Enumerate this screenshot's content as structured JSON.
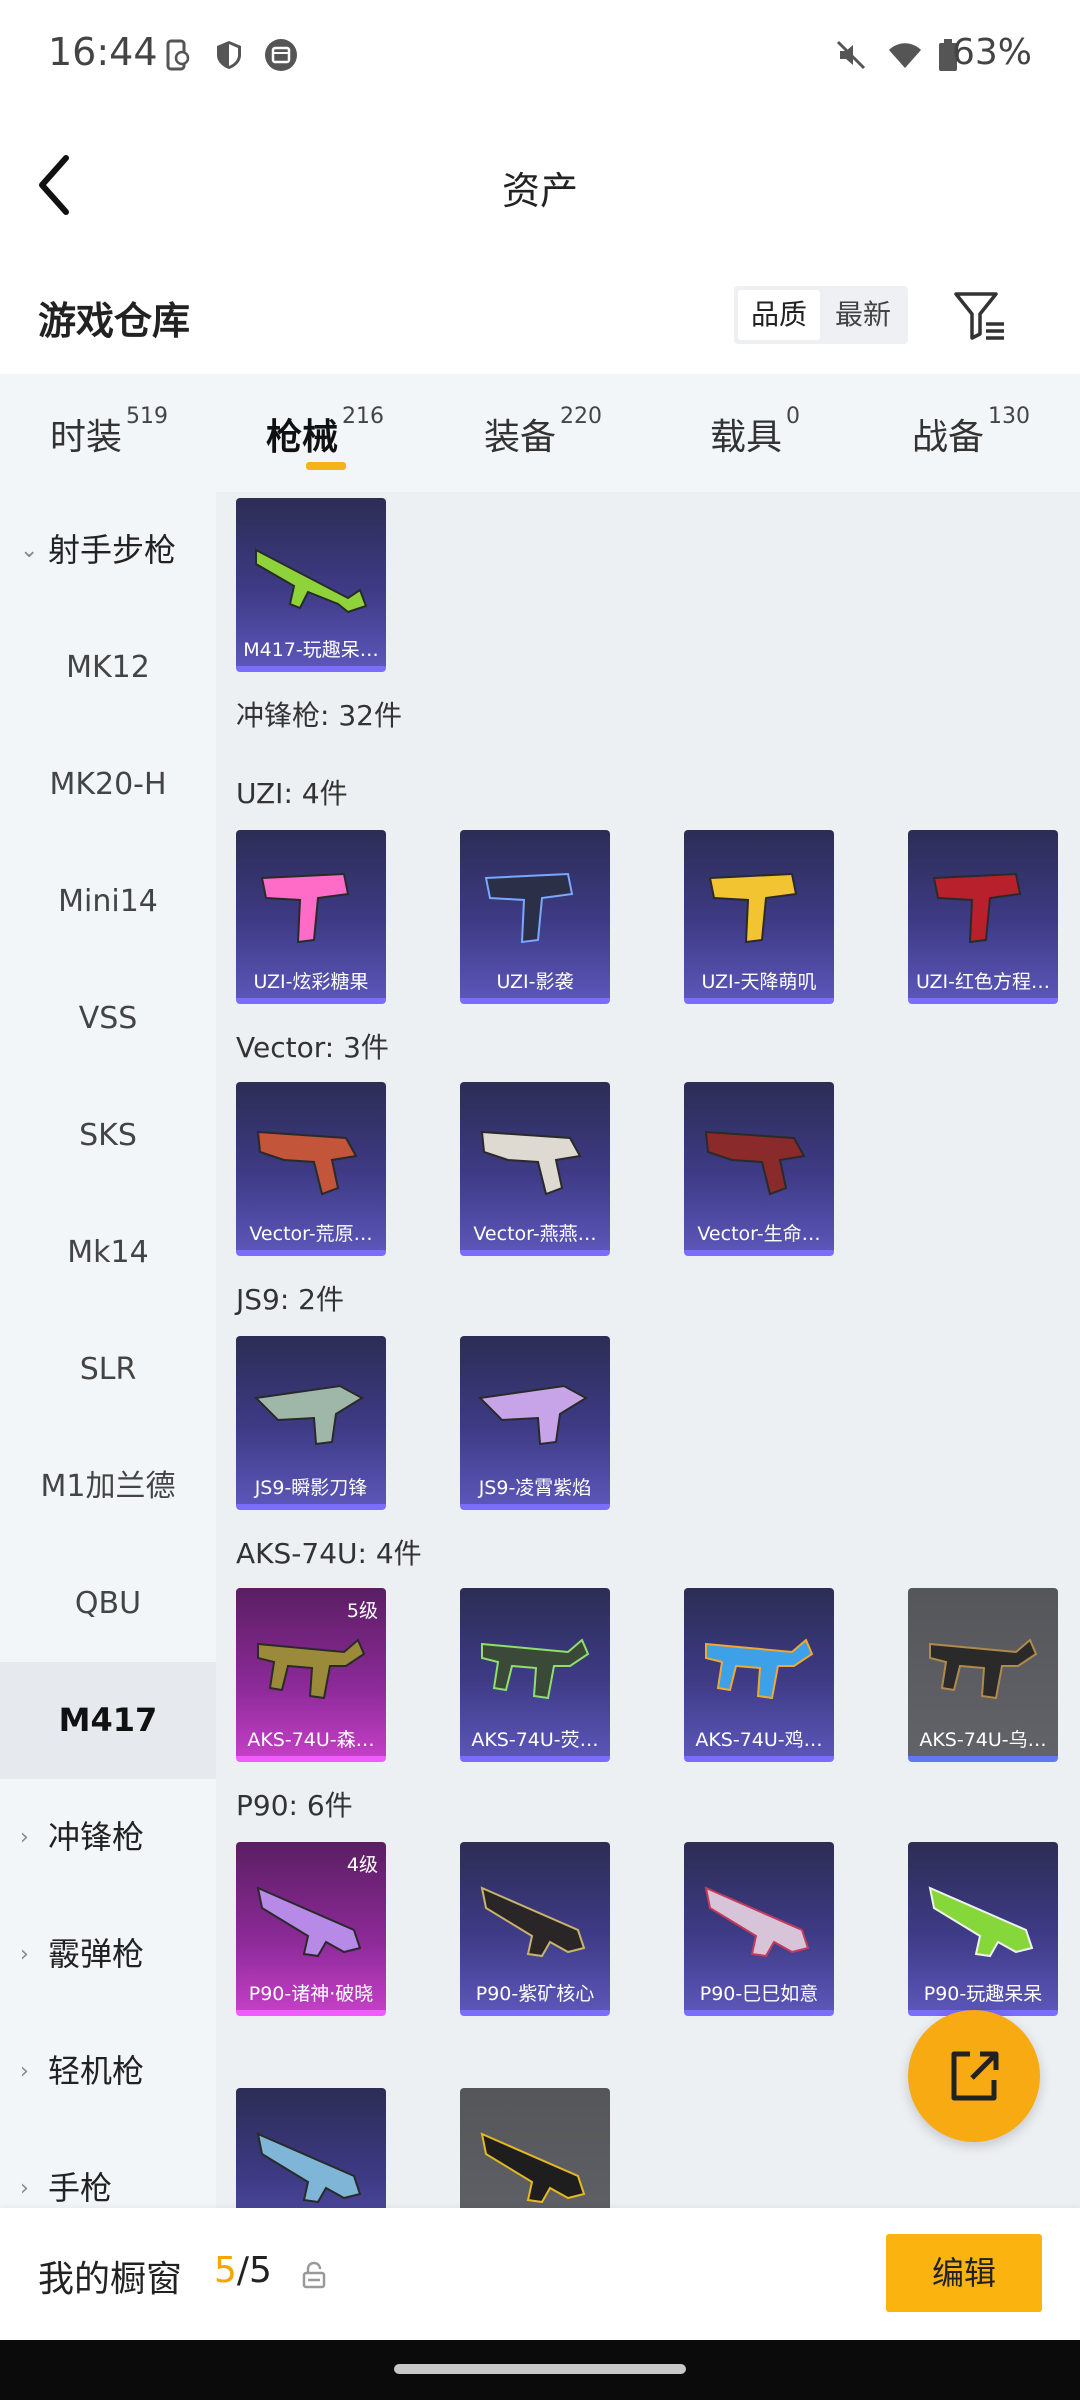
{
  "status_bar": {
    "time": "16:44",
    "battery": "63%"
  },
  "header": {
    "title": "资产"
  },
  "section": {
    "title": "游戏仓库",
    "sort_quality": "品质",
    "sort_newest": "最新"
  },
  "tabs": [
    {
      "label": "时装",
      "count": "519"
    },
    {
      "label": "枪械",
      "count": "216",
      "active": true
    },
    {
      "label": "装备",
      "count": "220"
    },
    {
      "label": "载具",
      "count": "0"
    },
    {
      "label": "战备",
      "count": "130"
    }
  ],
  "sidebar": {
    "group_rifle": "射手步枪",
    "items": [
      "MK12",
      "MK20-H",
      "Mini14",
      "VSS",
      "SKS",
      "Mk14",
      "SLR",
      "M1加兰德",
      "QBU",
      "M417"
    ],
    "active_item": "M417",
    "group_smg": "冲锋枪",
    "group_shotgun": "霰弹枪",
    "group_lmg": "轻机枪",
    "group_pistol": "手枪"
  },
  "content": {
    "m417_cards": [
      {
        "name": "M417-玩趣呆…"
      }
    ],
    "smg_total": "冲锋枪: 32件",
    "uzi_label": "UZI: 4件",
    "uzi_cards": [
      {
        "name": "UZI-炫彩糖果"
      },
      {
        "name": "UZI-影袭"
      },
      {
        "name": "UZI-天降萌叽"
      },
      {
        "name": "UZI-红色方程…"
      }
    ],
    "vector_label": "Vector: 3件",
    "vector_cards": [
      {
        "name": "Vector-荒原…"
      },
      {
        "name": "Vector-燕燕…"
      },
      {
        "name": "Vector-生命…"
      }
    ],
    "js9_label": "JS9: 2件",
    "js9_cards": [
      {
        "name": "JS9-瞬影刀锋"
      },
      {
        "name": "JS9-凌霄紫焰"
      }
    ],
    "aks_label": "AKS-74U: 4件",
    "aks_cards": [
      {
        "name": "AKS-74U-森…",
        "level": "5级"
      },
      {
        "name": "AKS-74U-荧…"
      },
      {
        "name": "AKS-74U-鸡…"
      },
      {
        "name": "AKS-74U-乌…"
      }
    ],
    "p90_label": "P90: 6件",
    "p90_cards": [
      {
        "name": "P90-诸神·破晓",
        "level": "4级"
      },
      {
        "name": "P90-紫矿核心"
      },
      {
        "name": "P90-巳巳如意"
      },
      {
        "name": "P90-玩趣呆呆"
      }
    ]
  },
  "bottom_bar": {
    "label": "我的橱窗",
    "current": "5",
    "total": "5",
    "edit_label": "编辑"
  },
  "colors": {
    "accent": "#f5b21b",
    "card_purple": "#3e3b86",
    "card_pink": "#8e2a9a"
  },
  "icons": [
    "back-arrow-icon",
    "filter-icon",
    "share-external-icon",
    "lock-icon"
  ]
}
